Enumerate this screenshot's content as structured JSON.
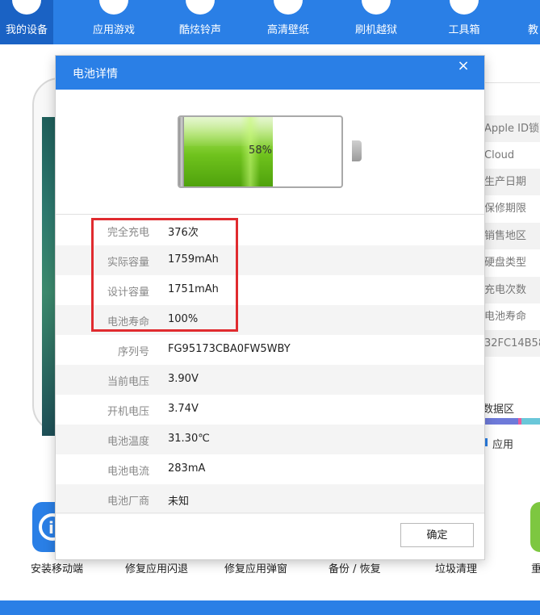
{
  "nav": {
    "items": [
      {
        "label": "我的设备"
      },
      {
        "label": "应用游戏"
      },
      {
        "label": "酷炫铃声"
      },
      {
        "label": "高清壁纸"
      },
      {
        "label": "刷机越狱"
      },
      {
        "label": "工具箱"
      },
      {
        "label": "教"
      }
    ]
  },
  "device_info": {
    "rows": [
      "Apple ID锁",
      "Cloud",
      "生产日期",
      "保修期限",
      "销售地区",
      "硬盘类型",
      "充电次数",
      "电池寿命",
      "32FC14B58"
    ],
    "data_section": "数据区",
    "legend_app": "应用"
  },
  "tools": {
    "labels": [
      "安装移动端",
      "修复应用闪退",
      "修复应用弹窗",
      "备份 / 恢复",
      "垃圾清理",
      "重"
    ]
  },
  "modal": {
    "title": "电池详情",
    "close": "×",
    "battery": {
      "percent_text": "58%",
      "level": 0.58
    },
    "rows": [
      {
        "label": "完全充电",
        "value": "376次"
      },
      {
        "label": "实际容量",
        "value": "1759mAh"
      },
      {
        "label": "设计容量",
        "value": "1751mAh"
      },
      {
        "label": "电池寿命",
        "value": "100%"
      },
      {
        "label": "序列号",
        "value": "FG95173CBA0FW5WBY"
      },
      {
        "label": "当前电压",
        "value": "3.90V"
      },
      {
        "label": "开机电压",
        "value": "3.74V"
      },
      {
        "label": "电池温度",
        "value": "31.30℃"
      },
      {
        "label": "电池电流",
        "value": "283mA"
      },
      {
        "label": "电池厂商",
        "value": "未知"
      }
    ],
    "ok_label": "确定"
  },
  "colors": {
    "accent": "#2a7fe6",
    "highlight": "#e02b2f",
    "battery_green": "#6fc21d"
  }
}
